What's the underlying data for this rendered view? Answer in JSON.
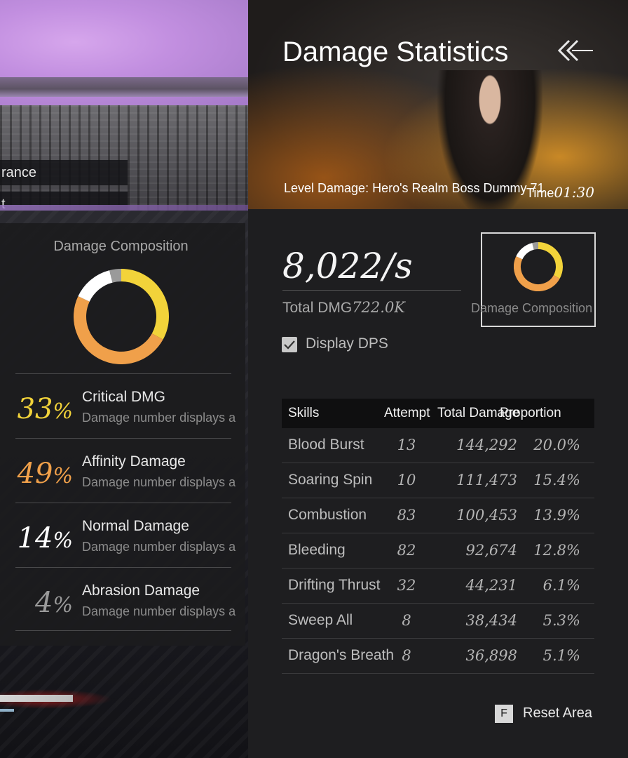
{
  "scene": {
    "bar1_text": "rance",
    "bar2_text": "t"
  },
  "composition_panel": {
    "title": "Damage Composition",
    "items": [
      {
        "percent": "33",
        "sign": "%",
        "name": "Critical DMG",
        "desc": "Damage number displays a",
        "color": "#f2d33a"
      },
      {
        "percent": "49",
        "sign": "%",
        "name": "Affinity Damage",
        "desc": "Damage number displays a",
        "color": "#f0a04a"
      },
      {
        "percent": "14",
        "sign": "%",
        "name": "Normal Damage",
        "desc": "Damage number displays a",
        "color": "#ffffff"
      },
      {
        "percent": "4",
        "sign": "%",
        "name": "Abrasion Damage",
        "desc": "Damage number displays a",
        "color": "#9a9a9a"
      }
    ]
  },
  "header": {
    "title": "Damage Statistics",
    "back_icon": "double-chevron-left-icon",
    "level_text": "Level Damage: Hero's Realm Boss Dummy   71",
    "time_label": "Time",
    "time_value": "01:30"
  },
  "stats": {
    "dps": "8,022/s",
    "total_label": "Total DMG",
    "total_value": "722.0K"
  },
  "composition_button": {
    "label": "Damage Composition"
  },
  "dps_toggle": {
    "label": "Display DPS",
    "checked": true
  },
  "table": {
    "headers": {
      "skill": "Skills",
      "attempt": "Attempt",
      "total": "Total Damage",
      "proportion": "Proportion"
    },
    "rows": [
      {
        "skill": "Blood Burst",
        "attempt": "13",
        "total": "144,292",
        "proportion": "20.0%"
      },
      {
        "skill": "Soaring Spin",
        "attempt": "10",
        "total": "111,473",
        "proportion": "15.4%"
      },
      {
        "skill": "Combustion",
        "attempt": "83",
        "total": "100,453",
        "proportion": "13.9%"
      },
      {
        "skill": "Bleeding",
        "attempt": "82",
        "total": "92,674",
        "proportion": "12.8%"
      },
      {
        "skill": "Drifting Thrust",
        "attempt": "32",
        "total": "44,231",
        "proportion": "6.1%"
      },
      {
        "skill": "Sweep All",
        "attempt": "8",
        "total": "38,434",
        "proportion": "5.3%"
      },
      {
        "skill": "Dragon's Breath",
        "attempt": "8",
        "total": "36,898",
        "proportion": "5.1%"
      }
    ]
  },
  "reset": {
    "key": "F",
    "label": "Reset Area"
  },
  "colors": {
    "critical": "#f2d33a",
    "affinity": "#f0a04a",
    "normal": "#ffffff",
    "abrasion": "#9a9a9a"
  }
}
